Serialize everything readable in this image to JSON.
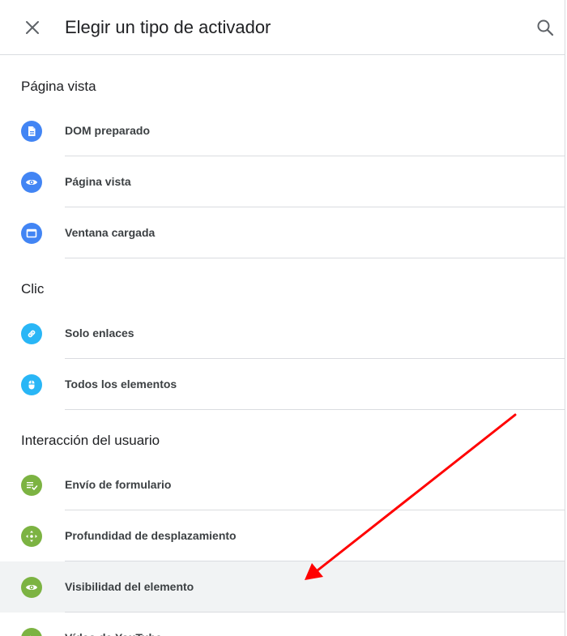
{
  "header": {
    "title": "Elegir un tipo de activador",
    "close_icon": "close-icon",
    "search_icon": "search-icon"
  },
  "sections": [
    {
      "title": "Página vista",
      "items": [
        {
          "label": "DOM preparado",
          "icon": "document-icon",
          "color": "#4285f4"
        },
        {
          "label": "Página vista",
          "icon": "eye-icon",
          "color": "#4285f4"
        },
        {
          "label": "Ventana cargada",
          "icon": "window-icon",
          "color": "#4285f4"
        }
      ]
    },
    {
      "title": "Clic",
      "items": [
        {
          "label": "Solo enlaces",
          "icon": "link-icon",
          "color": "#29b6f6"
        },
        {
          "label": "Todos los elementos",
          "icon": "mouse-icon",
          "color": "#29b6f6"
        }
      ]
    },
    {
      "title": "Interacción del usuario",
      "items": [
        {
          "label": "Envío de formulario",
          "icon": "form-check-icon",
          "color": "#7cb342"
        },
        {
          "label": "Profundidad de desplazamiento",
          "icon": "scroll-move-icon",
          "color": "#7cb342"
        },
        {
          "label": "Visibilidad del elemento",
          "icon": "eye-icon",
          "color": "#7cb342",
          "highlighted": true
        },
        {
          "label": "Vídeo de YouTube",
          "icon": "play-icon",
          "color": "#7cb342"
        }
      ]
    }
  ],
  "annotation": {
    "arrow_color": "#ff0000"
  }
}
